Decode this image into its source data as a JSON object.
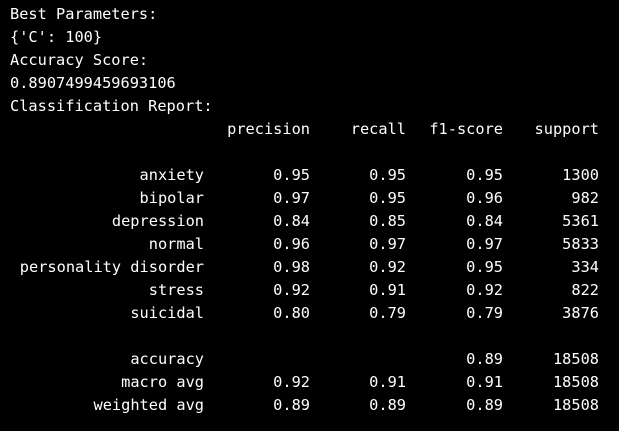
{
  "output": {
    "best_params_title": "Best Parameters:",
    "best_params_value": "{'C': 100}",
    "accuracy_title": "Accuracy Score:",
    "accuracy_value": "0.8907499459693106",
    "report_title": "Classification Report:"
  },
  "report": {
    "headers": {
      "precision": "precision",
      "recall": "recall",
      "f1": "f1-score",
      "support": "support"
    },
    "rows": [
      {
        "label": "anxiety",
        "precision": "0.95",
        "recall": "0.95",
        "f1": "0.95",
        "support": "1300"
      },
      {
        "label": "bipolar",
        "precision": "0.97",
        "recall": "0.95",
        "f1": "0.96",
        "support": "982"
      },
      {
        "label": "depression",
        "precision": "0.84",
        "recall": "0.85",
        "f1": "0.84",
        "support": "5361"
      },
      {
        "label": "normal",
        "precision": "0.96",
        "recall": "0.97",
        "f1": "0.97",
        "support": "5833"
      },
      {
        "label": "personality disorder",
        "precision": "0.98",
        "recall": "0.92",
        "f1": "0.95",
        "support": "334"
      },
      {
        "label": "stress",
        "precision": "0.92",
        "recall": "0.91",
        "f1": "0.92",
        "support": "822"
      },
      {
        "label": "suicidal",
        "precision": "0.80",
        "recall": "0.79",
        "f1": "0.79",
        "support": "3876"
      }
    ],
    "summary": [
      {
        "label": "accuracy",
        "precision": "",
        "recall": "",
        "f1": "0.89",
        "support": "18508"
      },
      {
        "label": "macro avg",
        "precision": "0.92",
        "recall": "0.91",
        "f1": "0.91",
        "support": "18508"
      },
      {
        "label": "weighted avg",
        "precision": "0.89",
        "recall": "0.89",
        "f1": "0.89",
        "support": "18508"
      }
    ]
  }
}
